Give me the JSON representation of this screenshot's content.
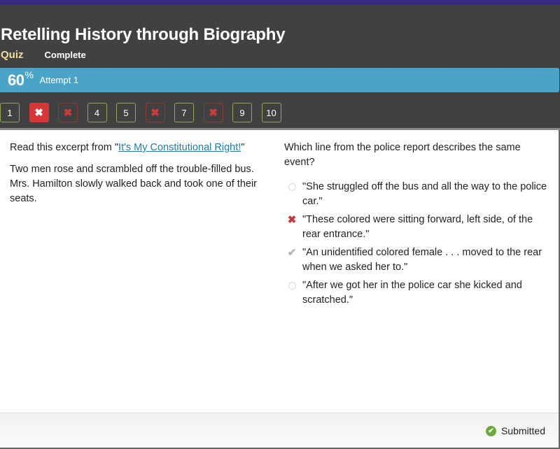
{
  "header": {
    "title": "Retelling History through Biography",
    "type_label": "Quiz",
    "status_label": "Complete"
  },
  "score": {
    "value": "60",
    "unit": "%",
    "attempt": "Attempt 1"
  },
  "colors": {
    "header_bg": "#414141",
    "score_bar": "#4aa4c8",
    "correct_outline": "#8ca858",
    "incorrect": "#d63838",
    "link": "#1a7fa8",
    "submitted_ok": "#6aab3a"
  },
  "question_nav": [
    {
      "label": "1",
      "state": "correct"
    },
    {
      "label": "✖",
      "state": "active-incorrect",
      "number": "2"
    },
    {
      "label": "✖",
      "state": "incorrect",
      "number": "3"
    },
    {
      "label": "4",
      "state": "correct"
    },
    {
      "label": "5",
      "state": "correct"
    },
    {
      "label": "✖",
      "state": "incorrect",
      "number": "6"
    },
    {
      "label": "7",
      "state": "correct"
    },
    {
      "label": "✖",
      "state": "incorrect",
      "number": "8"
    },
    {
      "label": "9",
      "state": "correct"
    },
    {
      "label": "10",
      "state": "correct"
    }
  ],
  "passage": {
    "intro_prefix": "Read this excerpt from \"",
    "link_text": "It's My Constitutional Right!",
    "intro_suffix": "\"",
    "excerpt": "Two men rose and scrambled off the trouble-filled bus. Mrs. Hamilton slowly walked back and took one of their seats."
  },
  "question": {
    "prompt": "Which line from the police report describes the same event?",
    "options": [
      {
        "text": "\"She struggled off the bus and all the way to the police car.\"",
        "marker": "radio-empty"
      },
      {
        "text": "\"These colored were sitting forward, left side, of the rear entrance.\"",
        "marker": "incorrect-selected"
      },
      {
        "text": "\"An unidentified colored female . . . moved to the rear when we asked her to.\"",
        "marker": "correct-answer"
      },
      {
        "text": "\"After we got her in the police car she kicked and scratched.\"",
        "marker": "radio-empty"
      }
    ]
  },
  "footer": {
    "status": "Submitted"
  }
}
